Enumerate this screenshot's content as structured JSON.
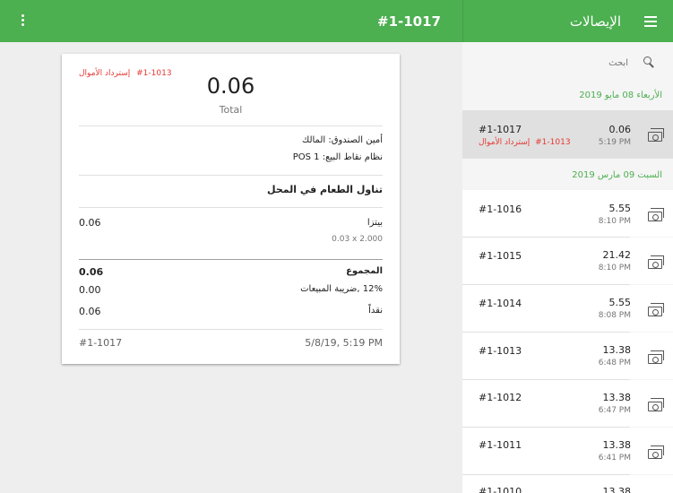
{
  "appbar": {
    "receipt_title": "#1-1017",
    "panel_title": "الإيصالات"
  },
  "receipt": {
    "refund_label": "إسترداد الأموال",
    "refund_ref": "#1-1013",
    "total_value": "0.06",
    "total_label": "Total",
    "cashier": "أمين الصندوق: المالك",
    "pos": "نظام نقاط البيع: POS 1",
    "dining_option": "تناول الطعام في المحل",
    "item": {
      "name": "بيتزا",
      "price": "0.06",
      "detail": "0.03 x 2.000"
    },
    "totals": [
      {
        "label": "المجموع",
        "value": "0.06"
      },
      {
        "label": "12% ,ضريبة المبيعات",
        "value": "0.00"
      },
      {
        "label": "نقداً",
        "value": "0.06"
      }
    ],
    "footer_number": "#1-1017",
    "footer_datetime": "5/8/19, 5:19 PM"
  },
  "list": {
    "search_placeholder": "ابحث",
    "groups": [
      {
        "date": "الأربعاء 08 مايو 2019",
        "rows": [
          {
            "number": "#1-1017",
            "amount": "0.06",
            "time": "5:19 PM",
            "refund_ref": "#1-1013",
            "refund_label": "إسترداد الأموال",
            "selected": true
          }
        ]
      },
      {
        "date": "السبت 09 مارس 2019",
        "rows": [
          {
            "number": "#1-1016",
            "amount": "5.55",
            "time": "8:10 PM"
          },
          {
            "number": "#1-1015",
            "amount": "21.42",
            "time": "8:10 PM"
          },
          {
            "number": "#1-1014",
            "amount": "5.55",
            "time": "8:08 PM"
          },
          {
            "number": "#1-1013",
            "amount": "13.38",
            "time": "6:48 PM"
          },
          {
            "number": "#1-1012",
            "amount": "13.38",
            "time": "6:47 PM"
          },
          {
            "number": "#1-1011",
            "amount": "13.38",
            "time": "6:41 PM"
          },
          {
            "number": "#1-1010",
            "amount": "13.38",
            "time": ""
          }
        ]
      }
    ]
  },
  "colors": {
    "primary": "#4caf50",
    "refund": "#e53935"
  },
  "icons": {
    "menu": "menu-icon",
    "overflow": "more-vert-icon",
    "search": "search-icon",
    "receipt": "cash-icon"
  }
}
